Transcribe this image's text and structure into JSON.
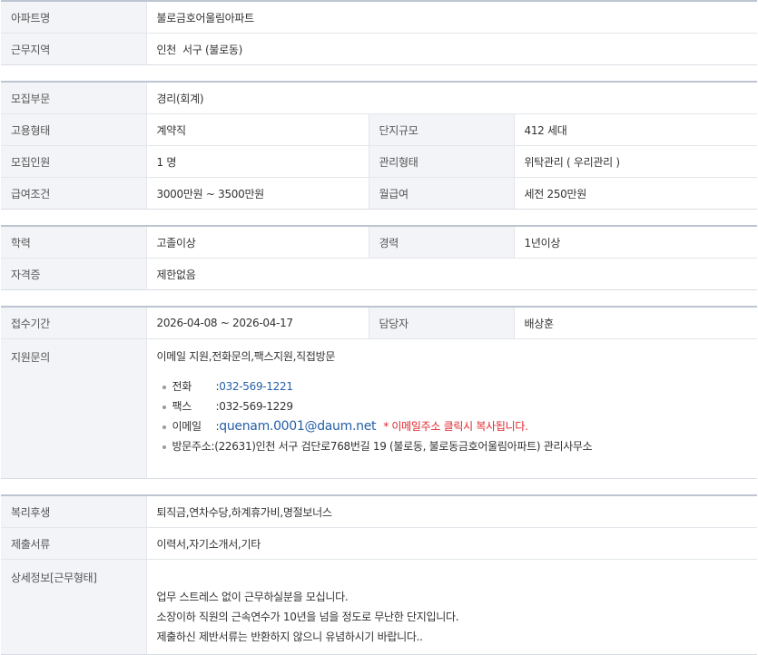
{
  "sec1": {
    "apt_label": "아파트명",
    "apt_value": "불로금호어울림아파트",
    "region_label": "근무지역",
    "region_value": "인천  서구 (불로동)"
  },
  "sec2": {
    "dept_label": "모집부문",
    "dept_value": "경리(회계)",
    "emp_label": "고용형태",
    "emp_value": "계약직",
    "size_label": "단지규모",
    "size_value": "412 세대",
    "count_label": "모집인원",
    "count_value": "1 명",
    "mgmt_label": "관리형태",
    "mgmt_value": "위탁관리 ( 우리관리 )",
    "pay_label": "급여조건",
    "pay_value": "3000만원 ~ 3500만원",
    "monthly_label": "월급여",
    "monthly_value": "세전 250만원"
  },
  "sec3": {
    "edu_label": "학력",
    "edu_value": "고졸이상",
    "exp_label": "경력",
    "exp_value": "1년이상",
    "cert_label": "자격증",
    "cert_value": "제한없음"
  },
  "sec4": {
    "period_label": "접수기간",
    "period_value": "2026-04-08 ~ 2026-04-17",
    "manager_label": "담당자",
    "manager_value": "배상훈",
    "inquiry_label": "지원문의",
    "inquiry_methods": "이메일 지원,전화문의,팩스지원,직접방문",
    "phone_key": "전화",
    "phone_value": "032-569-1221",
    "fax_key": "팩스",
    "fax_value": "032-569-1229",
    "email_key": "이메일",
    "email_value": "quenam.0001@daum.net",
    "email_note": "* 이메일주소 클릭시 복사됩니다.",
    "addr_key": "방문주소",
    "addr_value": "(22631)인천 서구 검단로768번길 19 (불로동, 불로동금호어울림아파트) 관리사무소"
  },
  "sec5": {
    "welfare_label": "복리후생",
    "welfare_value": "퇴직금,연차수당,하계휴가비,명절보너스",
    "docs_label": "제출서류",
    "docs_value": "이력서,자기소개서,기타",
    "detail_label": "상세정보[근무형태]",
    "detail_lines": [
      "업무 스트레스 없이 근무하실분을 모십니다.",
      "소장이하 직원의 근속연수가 10년을 넘을 정도로 무난한 단지입니다.",
      "제출하신 제반서류는 반환하지 않으니 유념하시기 바랍니다.."
    ]
  }
}
